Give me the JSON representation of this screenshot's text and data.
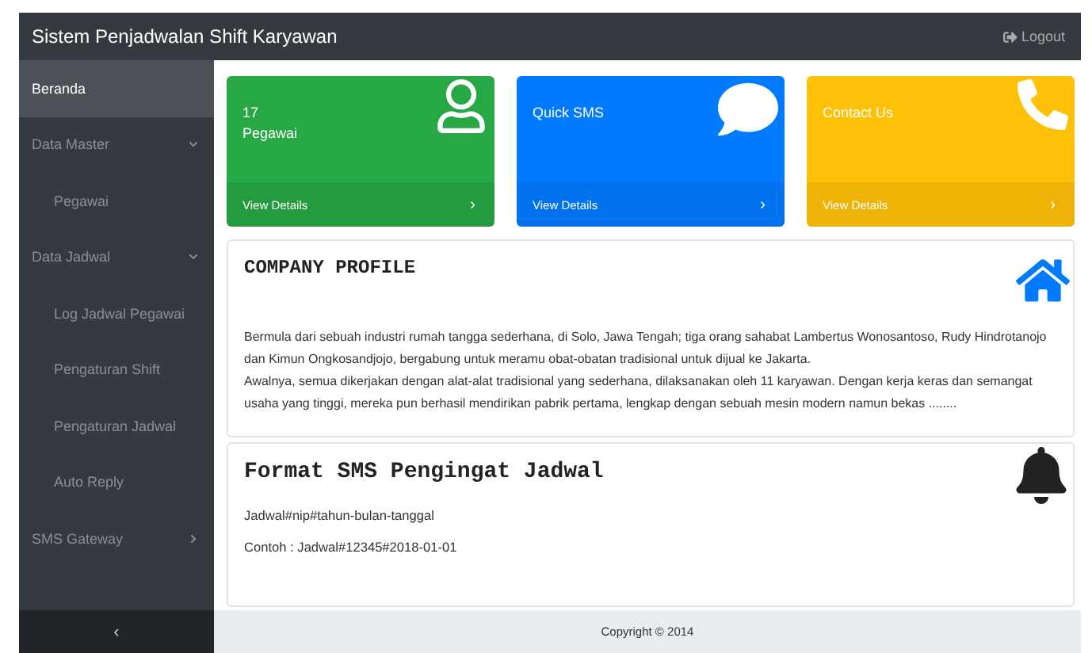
{
  "navbar": {
    "title": "Sistem Penjadwalan Shift Karyawan",
    "logout": "Logout"
  },
  "sidebar": {
    "items": [
      {
        "label": "Beranda",
        "selected": true
      },
      {
        "label": "Data Master",
        "selected": false,
        "expanded": true,
        "children": [
          {
            "label": "Pegawai",
            "selected": false
          }
        ]
      },
      {
        "label": "Data Jadwal",
        "selected": false,
        "expanded": true,
        "children": [
          {
            "label": "Log Jadwal Pegawai",
            "selected": false
          },
          {
            "label": "Pengaturan Shift",
            "selected": false
          },
          {
            "label": "Pengaturan Jadwal",
            "selected": false
          },
          {
            "label": "Auto Reply",
            "selected": false
          }
        ]
      },
      {
        "label": "SMS Gateway",
        "selected": false,
        "expanded": false
      }
    ],
    "collapse": "‹"
  },
  "cards": [
    {
      "kind": "users",
      "color": "#28a745",
      "lines": [
        "17",
        "Pegawai"
      ],
      "link": "View Details",
      "arrow": "›"
    },
    {
      "kind": "sms",
      "color": "#007bff",
      "lines": [
        "Quick SMS"
      ],
      "link": "View Details",
      "arrow": "›"
    },
    {
      "kind": "contact",
      "color": "#ffc107",
      "lines": [
        "Contact Us"
      ],
      "link": "View Details",
      "arrow": "›"
    }
  ],
  "panels": [
    {
      "kind": "profile",
      "title": "COMPANY PROFILE",
      "paragraphs": [
        "Bermula dari sebuah industri rumah tangga sederhana, di Solo, Jawa Tengah; tiga orang sahabat Lambertus Wonosantoso, Rudy Hindrotanojo dan Kimun Ongkosandjojo, bergabung untuk meramu obat-obatan tradisional untuk dijual ke Jakarta.",
        "Awalnya, semua dikerjakan dengan alat-alat tradisional yang sederhana, dilaksanakan oleh 11 karyawan. Dengan kerja keras dan semangat usaha yang tinggi, mereka pun berhasil mendirikan pabrik pertama, lengkap dengan sebuah mesin modern namun bekas ........"
      ]
    },
    {
      "kind": "sms",
      "title": "Format SMS Pengingat Jadwal",
      "paragraphs": [
        "Jadwal#nip#tahun-bulan-tanggal",
        "Contoh : Jadwal#12345#2018-01-01"
      ]
    }
  ],
  "footer": "Copyright © 2014"
}
